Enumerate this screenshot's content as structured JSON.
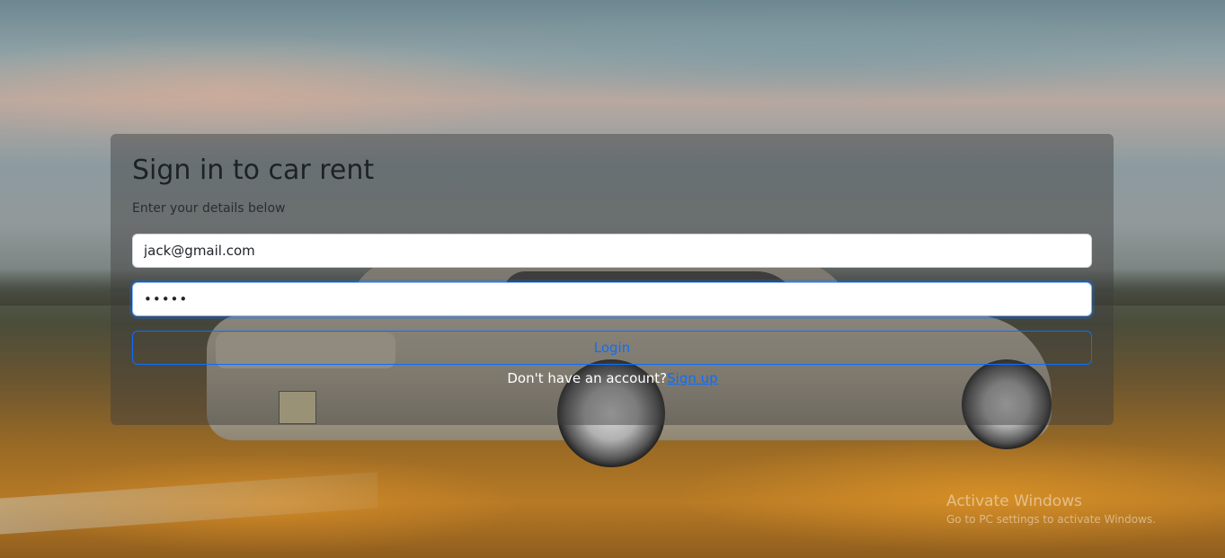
{
  "page": {
    "title": "Sign in to car rent",
    "subtitle": "Enter your details below"
  },
  "form": {
    "email_value": "jack@gmail.com",
    "password_value": "•••••",
    "login_label": "Login",
    "no_account_text": "Don't have an account?",
    "signup_label": "Sign up"
  },
  "watermark": {
    "title": "Activate Windows",
    "subtitle": "Go to PC settings to activate Windows."
  },
  "colors": {
    "accent": "#0d6efd",
    "panel": "rgba(60,60,60,0.45)"
  }
}
